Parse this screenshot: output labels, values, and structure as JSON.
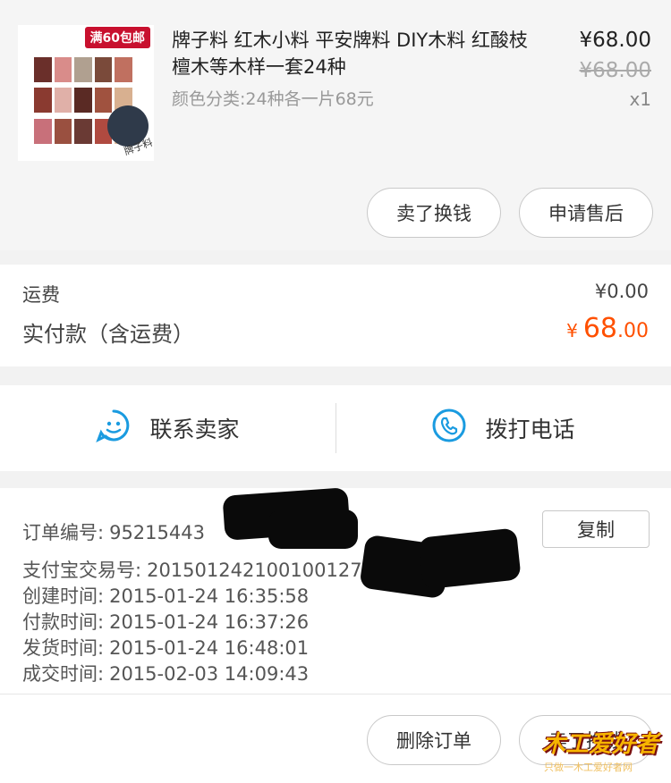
{
  "product": {
    "badge": "满60包邮",
    "thumb_caption": "牌子料",
    "title": "牌子料 红木小料 平安牌料 DIY木料 红酸枝 檀木等木样一套24种",
    "variant": "颜色分类:24种各一片68元",
    "price": "¥68.00",
    "original_price": "¥68.00",
    "quantity": "x1",
    "buttons": {
      "sell": "卖了换钱",
      "after_sale": "申请售后"
    }
  },
  "cost": {
    "shipping_label": "运费",
    "shipping_value": "¥0.00",
    "paid_label": "实付款（含运费）",
    "paid_currency": "¥",
    "paid_integer": "68",
    "paid_decimal": ".00"
  },
  "contact": {
    "seller_label": "联系卖家",
    "phone_label": "拨打电话",
    "seller_icon": "smiley-chat-icon",
    "phone_icon": "phone-icon"
  },
  "order_info": {
    "order_no_label": "订单编号:",
    "order_no_value": "95215443",
    "copy_label": "复制",
    "alipay_label": "支付宝交易号:",
    "alipay_value": "201501242100100127001",
    "created_label": "创建时间:",
    "created_value": "2015-01-24 16:35:58",
    "paid_label": "付款时间:",
    "paid_value": "2015-01-24 16:37:26",
    "shipped_label": "发货时间:",
    "shipped_value": "2015-01-24 16:48:01",
    "closed_label": "成交时间:",
    "closed_value": "2015-02-03 14:09:43"
  },
  "bottom_actions": {
    "delete_label": "删除订单",
    "sell_label": "卖了换钱"
  },
  "watermark": {
    "brand": "木工爱好者",
    "sub": "只做一木工爱好者网"
  },
  "colors": {
    "accent_orange": "#ff5000",
    "icon_blue": "#1a9be0"
  }
}
